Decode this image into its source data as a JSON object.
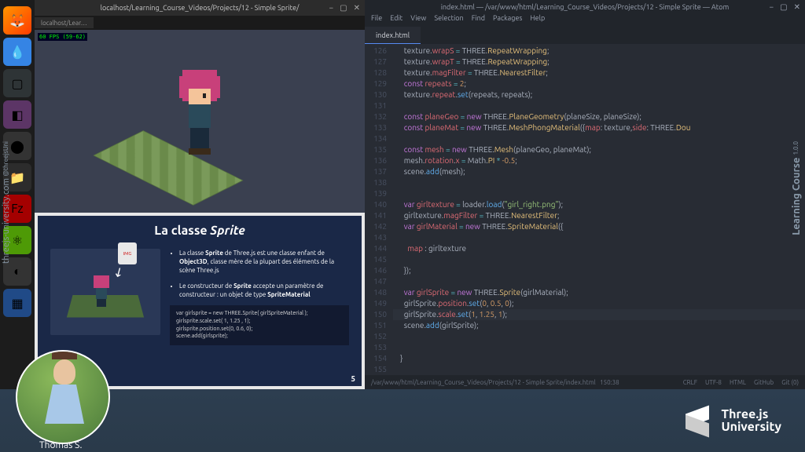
{
  "browser": {
    "title": "localhost/Learning_Course_Videos/Projects/12 - Simple Sprite/",
    "tab": "localhost/Lear…",
    "fps": "60 FPS (59-62)"
  },
  "slide": {
    "title_pre": "La classe ",
    "title_em": "Sprite",
    "badge": "IMG",
    "bullet1_a": "La classe ",
    "bullet1_b": "Sprite",
    "bullet1_c": " de Three.js est une classe enfant de ",
    "bullet1_d": "Object3D",
    "bullet1_e": ", classe mère de la plupart des éléments de la scène Three.js",
    "bullet2_a": "Le constructeur de ",
    "bullet2_b": "Sprite",
    "bullet2_c": " accepte un paramètre de constructeur : un objet de type ",
    "bullet2_d": "SpriteMaterial",
    "code1": "var girlsprite = new THREE.Sprite( girlSpriteMaterial );",
    "code2": "girlsprite.scale.set( 1, 1.25 , 1);",
    "code3": "girlsprite.position.set(0, 0.6, 0);",
    "code4": "scene.add(girlsprite);",
    "page_num": "5"
  },
  "editor": {
    "title": "index.html — /var/www/html/Learning_Course_Videos/Projects/12 - Simple Sprite — Atom",
    "menu": [
      "File",
      "Edit",
      "View",
      "Selection",
      "Find",
      "Packages",
      "Help"
    ],
    "tab": "index.html",
    "first_line": 126,
    "status_path": "/var/www/html/Learning_Course_Videos/Projects/12 - Simple Sprite/index.html",
    "status_pos": "150:38",
    "status_right": [
      "CRLF",
      "UTF-8",
      "HTML",
      "GitHub",
      "Git (0)"
    ]
  },
  "footer": {
    "author": "Thomas S.",
    "logo_line1": "Three.js",
    "logo_line2": "University"
  },
  "side": {
    "left_main": "threejs-university.com",
    "left_sub": "@threejsUni",
    "right_main": "Learning Course",
    "right_sub": "1.0.0"
  }
}
